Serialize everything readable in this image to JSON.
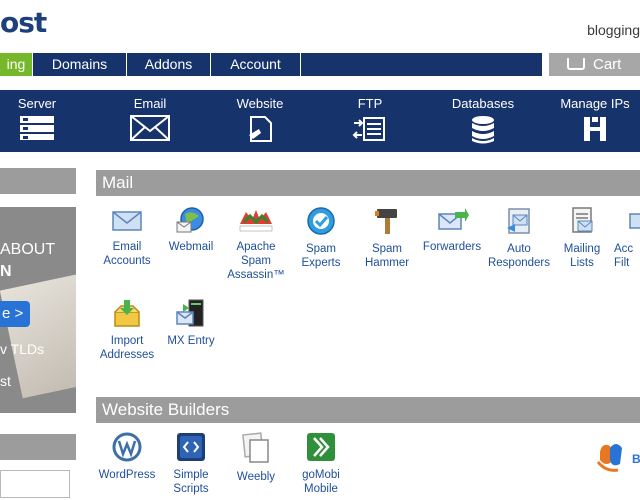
{
  "header": {
    "logo_text": "ost",
    "domain_text": "blogging"
  },
  "topnav": {
    "tabs": [
      {
        "label": "ing",
        "active": true
      },
      {
        "label": "Domains",
        "active": false
      },
      {
        "label": "Addons",
        "active": false
      },
      {
        "label": "Account",
        "active": false
      }
    ],
    "cart_label": "Cart"
  },
  "iconbar": {
    "items": [
      {
        "label": "Server",
        "icon": "server-icon"
      },
      {
        "label": "Email",
        "icon": "envelope-icon"
      },
      {
        "label": "Website",
        "icon": "website-icon"
      },
      {
        "label": "FTP",
        "icon": "ftp-icon"
      },
      {
        "label": "Databases",
        "icon": "database-icon"
      },
      {
        "label": "Manage IPs",
        "icon": "network-icon"
      }
    ]
  },
  "promo": {
    "line1": "ABOUT",
    "line2": "N",
    "button_label": "e >",
    "line3": "v TLDs",
    "line4": "st"
  },
  "mail": {
    "title": "Mail",
    "apps": [
      {
        "label": "Email\nAccounts",
        "icon": "email-accounts-icon"
      },
      {
        "label": "Webmail",
        "icon": "webmail-icon"
      },
      {
        "label": "Apache\nSpam\nAssassin™",
        "icon": "spamassassin-icon"
      },
      {
        "label": "Spam\nExperts",
        "icon": "spam-experts-icon"
      },
      {
        "label": "Spam\nHammer",
        "icon": "spam-hammer-icon"
      },
      {
        "label": "Forwarders",
        "icon": "forwarders-icon"
      },
      {
        "label": "Auto\nResponders",
        "icon": "auto-responders-icon"
      },
      {
        "label": "Mailing\nLists",
        "icon": "mailing-lists-icon"
      },
      {
        "label": "Acc\nFilt",
        "icon": "account-filters-icon"
      },
      {
        "label": "Import\nAddresses",
        "icon": "import-addresses-icon"
      },
      {
        "label": "MX Entry",
        "icon": "mx-entry-icon"
      }
    ]
  },
  "website_builders": {
    "title": "Website Builders",
    "apps": [
      {
        "label": "WordPress",
        "icon": "wordpress-icon"
      },
      {
        "label": "Simple\nScripts",
        "icon": "simple-scripts-icon"
      },
      {
        "label": "Weebly",
        "icon": "weebly-icon"
      },
      {
        "label": "goMobi\nMobile",
        "icon": "gomobi-icon"
      }
    ],
    "partner_text": "B"
  },
  "colors": {
    "nav_blue": "#17336b",
    "active_green": "#77b82b",
    "section_gray": "#9c9c9c",
    "link_blue": "#1e4f9c"
  }
}
